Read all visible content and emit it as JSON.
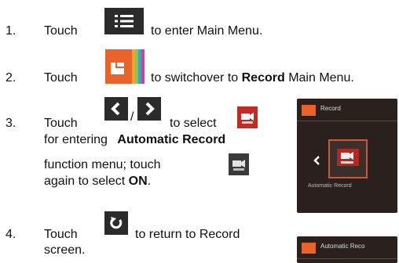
{
  "steps": [
    {
      "number": "1.",
      "pre": "Touch",
      "post": "to enter Main Menu."
    },
    {
      "number": "2.",
      "pre": "Touch",
      "post": "to switchover to",
      "bold": "Record",
      "tail": "Main Menu."
    },
    {
      "number": "3.",
      "pre": "Touch",
      "sep": "/",
      "mid": "to select",
      "line2_pre": "for entering",
      "line2_bold": "Automatic Record",
      "line3": "function menu; touch",
      "line4_pre": "again to select",
      "line4_bold": "ON",
      "line4_post": "."
    },
    {
      "number": "4.",
      "pre": "Touch",
      "post": "to return to Record",
      "line2": "screen."
    }
  ],
  "screenshot1": {
    "header": "Record",
    "caption": "Automatic Record"
  },
  "screenshot2": {
    "header": "Automatic Reco"
  },
  "icons": {
    "menu": "menu-list-icon",
    "record_mode": "record-mode-icon",
    "left": "left-arrow-icon",
    "right": "right-arrow-icon",
    "auto_record": "auto-record-icon",
    "return": "return-icon"
  },
  "colors": {
    "icon_dark": "#2b2b2b",
    "record_orange": "#e8622a",
    "auto_red": "#c42a24",
    "screen_bg": "#2a211e"
  }
}
